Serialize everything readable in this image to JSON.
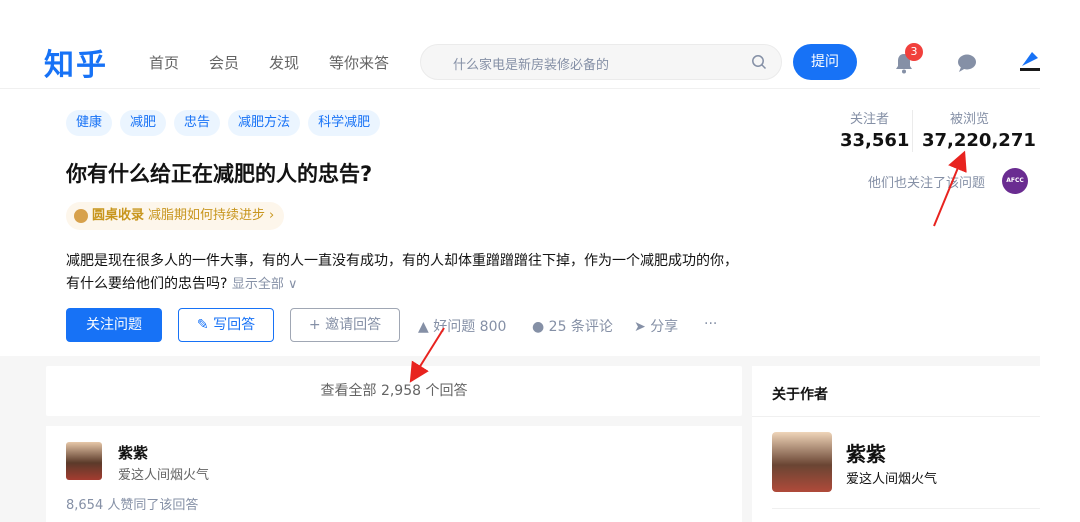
{
  "header": {
    "logo": "知乎",
    "nav": [
      "首页",
      "会员",
      "发现",
      "等你来答"
    ],
    "search_placeholder": "什么家电是新房装修必备的",
    "ask_label": "提问",
    "notification_count": "3",
    "brand_color": "#1772f6"
  },
  "question": {
    "tags": [
      "健康",
      "减肥",
      "忠告",
      "减肥方法",
      "科学减肥"
    ],
    "title": "你有什么给正在减肥的人的忠告?",
    "roundtable_label": "圆桌收录",
    "roundtable_text": "减脂期如何持续进步",
    "description": "减肥是现在很多人的一件大事，有的人一直没有成功，有的人却体重蹭蹭蹭往下掉，作为一个减肥成功的你，有什么要给他们的忠告吗?",
    "show_all": "显示全部 ∨"
  },
  "actions": {
    "follow": "关注问题",
    "write": "写回答",
    "invite": "邀请回答",
    "good_question": "好问题 800",
    "comments": "25 条评论",
    "share": "分享",
    "more": "···"
  },
  "stats": {
    "followers_label": "关注者",
    "followers_value": "33,561",
    "views_label": "被浏览",
    "views_value": "37,220,271",
    "also_follow": "他们也关注了该问题",
    "org_badge": "AFCC"
  },
  "answers": {
    "view_all": "查看全部 2,958 个回答",
    "first": {
      "name": "紫紫",
      "bio": "爱这人间烟火气",
      "votes": "8,654 人赞同了该回答"
    }
  },
  "sidebar": {
    "title": "关于作者",
    "name": "紫紫",
    "bio": "爱这人间烟火气"
  },
  "annotation_color": "#e8231f"
}
